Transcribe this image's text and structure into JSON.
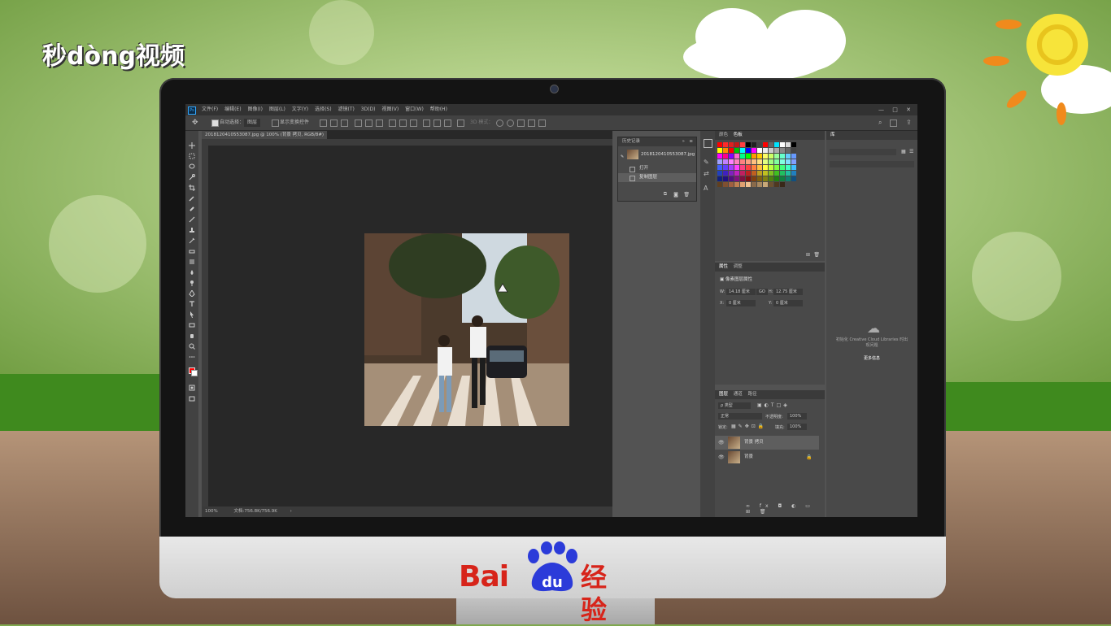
{
  "watermark": "秒dòng视频",
  "app": {
    "menus": [
      "文件(F)",
      "编辑(E)",
      "图像(I)",
      "图层(L)",
      "文字(Y)",
      "选择(S)",
      "滤镜(T)",
      "3D(D)",
      "视图(V)",
      "窗口(W)",
      "帮助(H)"
    ],
    "window_controls": [
      "—",
      "□",
      "✕"
    ],
    "options": {
      "auto_select_label": "自动选择：",
      "auto_select_value": "图层",
      "transform_label": "显示变换控件",
      "mode_3d_label": "3D 模式："
    },
    "document_tab": "20181204105530​87.jpg @ 100% (背景 拷贝, RGB/8#) *  ×",
    "status": {
      "zoom": "100%",
      "doc_info": "文档:756.8K/756.9K"
    },
    "history": {
      "title": "历史记录",
      "snapshot": "20181204105530​87.jpg",
      "items": [
        "打开",
        "复制图层"
      ]
    },
    "swatches": {
      "tabs": [
        "颜色",
        "色板"
      ]
    },
    "properties": {
      "tabs": [
        "属性",
        "调整"
      ],
      "layer_type": "像素图层属性",
      "w_label": "W:",
      "w_value": "14.18 厘米",
      "go_label": "GO",
      "h_label": "H:",
      "h_value": "12.75 厘米",
      "x_label": "X:",
      "x_value": "0 厘米",
      "y_label": "Y:",
      "y_value": "0 厘米"
    },
    "layers": {
      "tabs": [
        "图层",
        "通道",
        "路径"
      ],
      "filter_label": "ρ 类型",
      "blend_mode": "正常",
      "opacity_label": "不透明度:",
      "opacity_value": "100%",
      "lock_label": "锁定:",
      "fill_label": "填充:",
      "fill_value": "100%",
      "items": [
        "背景 拷贝",
        "背景"
      ]
    },
    "library": {
      "tab": "库",
      "message": "初始化 Creative Cloud Libraries 时出现问题",
      "link": "更多信息"
    }
  },
  "brand": {
    "left": "Bai",
    "du": "du",
    "right": "经验"
  }
}
